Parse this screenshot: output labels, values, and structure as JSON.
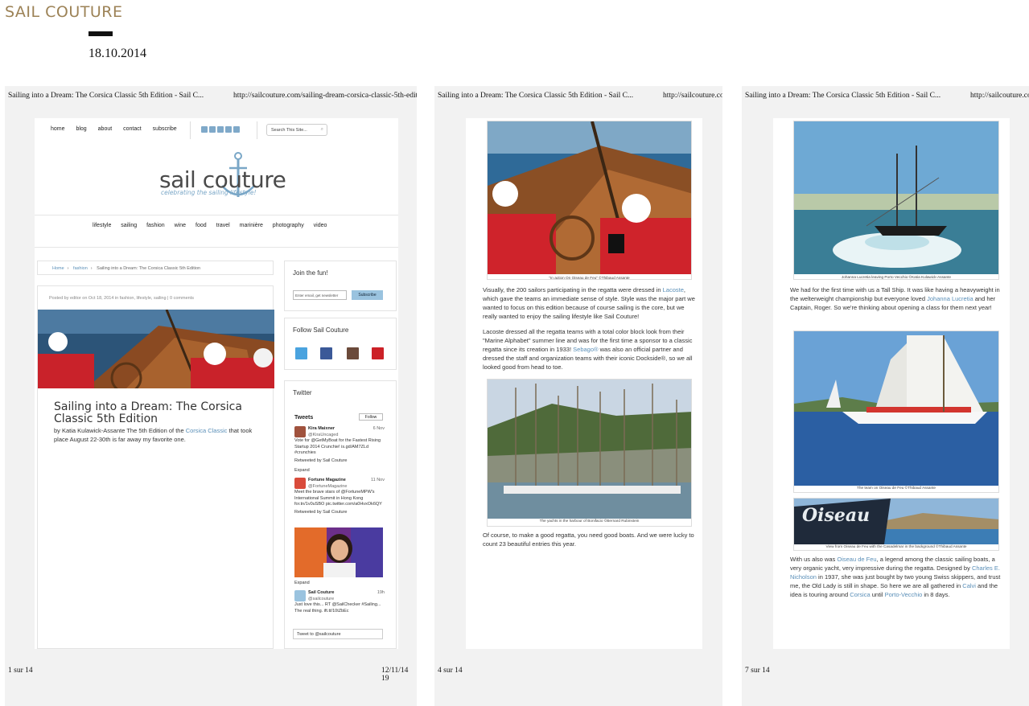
{
  "brand": "SAIL COUTURE",
  "date": "18.10.2014",
  "pages": [
    {
      "header_title": "Sailing into a Dream: The Corsica Classic 5th Edition - Sail C...",
      "header_url": "http://sailcouture.com/sailing-dream-corsica-classic-5th-editi",
      "footer_page": "1 sur 14",
      "footer_date": "12/11/14 19"
    },
    {
      "header_title": "Sailing into a Dream: The Corsica Classic 5th Edition - Sail C...",
      "header_url": "http://sailcouture.co",
      "footer_page": "4 sur 14"
    },
    {
      "header_title": "Sailing into a Dream: The Corsica Classic 5th Edition - Sail C...",
      "header_url": "http://sailcouture.com",
      "footer_page": "7 sur 14"
    }
  ],
  "site": {
    "top_nav": [
      "home",
      "blog",
      "about",
      "contact",
      "subscribe"
    ],
    "search_placeholder": "Search This Site...",
    "logo_text": "sail couture",
    "logo_tagline": "celebrating the sailing lifestyle!",
    "main_nav": [
      "lifestyle",
      "sailing",
      "fashion",
      "wine",
      "food",
      "travel",
      "marinière",
      "photography",
      "video"
    ],
    "breadcrumb": [
      "Home",
      "fashion",
      "Sailing into a Dream: The Corsica Classic 5th Edition"
    ],
    "posted": "Posted by editor on Oct 18, 2014 in fashion, lifestyle, sailing | 0 comments",
    "post_title": "Sailing into a Dream: The Corsica Classic 5th Edition",
    "post_intro_before": "by Katia Kulawick-Assante The 5th Edition of the ",
    "post_intro_link": "Corsica Classic",
    "post_intro_after": " that took place August 22-30th is far away my favorite one."
  },
  "sidebar": {
    "join_title": "Join the fun!",
    "email_placeholder": "Enter email, get newsletter",
    "subscribe_label": "Subscribe",
    "follow_title": "Follow Sail Couture",
    "twitter_title": "Twitter",
    "tweets_label": "Tweets",
    "follow_label": "Follow",
    "tweets": [
      {
        "name": "Kira Maixner",
        "handle": "@KiraUncaged",
        "when": "6 Nov",
        "text": "Vote for @GetMyBoat for the Fastest Rising Startup 2014 Crunchie! is.gd/AM7ZLd #crunchies",
        "retweet": "Retweeted by Sail Couture"
      },
      {
        "name": "Fortune Magazine",
        "handle": "@FortuneMagazine",
        "when": "11 Nov",
        "text": "Meet the brave stars of @FortuneMPW's International Summit in Hong Kong for.tn/1v0uSBO pic.twitter.com/a0HvxOk6QY",
        "retweet": "Retweeted by Sail Couture"
      },
      {
        "name": "Sail Couture",
        "handle": "@sailcouture",
        "when": "19h",
        "text": "Just love this... RT @SailChecker #Sailing... The real thing. ift.tt/10tZbEc",
        "retweet": ""
      }
    ],
    "expand_label": "Expand",
    "tweet_to": "Tweet to @sailcouture"
  },
  "page2": {
    "caption1": "\"In action On Oiseau de Feu\" ©Thibaud Assante",
    "para1_a": "Visually, the 200 sailors participating in the regatta were dressed in ",
    "para1_link": "Lacoste",
    "para1_b": ", which gave the teams an immediate sense of style. Style was the major part we wanted to focus on this edition because of course sailing is the core, but we really wanted to enjoy the sailing lifestyle like Sail Couture!",
    "para2_a": "Lacoste dressed all the regatta teams with a total color block look from their \"Marine Alphabet\" summer line and was for the first time a sponsor to a classic regatta since its creation in 1933! ",
    "para2_link": "Sebago®",
    "para2_b": " was also an official partner and dressed the staff and organization teams with their iconic Dockside®, so we all looked good from head to toe.",
    "caption2": "The yachts in the harbour of Bonifacio ©Bernard Rubinstein",
    "para3": "Of course, to make a good regatta, you need good boats. And we were lucky to count 23 beautiful entries this year."
  },
  "page3": {
    "caption1": "Johanna Lucretia leaving Porto Vecchio ©Katia Kulawick-Assante",
    "para1_a": "We had for the first time with us a Tall Ship. It was like having a heavyweight in the welterweight championship but everyone loved ",
    "para1_link": "Johanna Lucretia",
    "para1_b": " and her Captain, Roger. So we're thinking about opening a class for them next year!",
    "caption2": "The team on Oiseau de Feu ©Thibaud Assante",
    "banner_text": "Oiseau",
    "caption3": "View from Oiseau de Feu with the Casadelmar in the background ©Thibaud Assante",
    "para2_a": "With us also was ",
    "para2_l1": "Oiseau de Feu",
    "para2_b": ", a legend among the classic sailing boats, a very organic yacht, very impressive during the regatta. Designed by ",
    "para2_l2": "Charles E. Nicholson",
    "para2_c": " in 1937, she was just bought by two young Swiss skippers, and trust me, the Old Lady is still in shape. So here we are all gathered in ",
    "para2_l3": "Calvi",
    "para2_d": " and the idea is touring around ",
    "para2_l4": "Corsica",
    "para2_e": " until ",
    "para2_l5": "Porto-Vecchio",
    "para2_f": " in 8 days."
  },
  "colors": {
    "brand": "#9c8256",
    "link": "#5a8fb8",
    "accent": "#7aa7c7"
  }
}
